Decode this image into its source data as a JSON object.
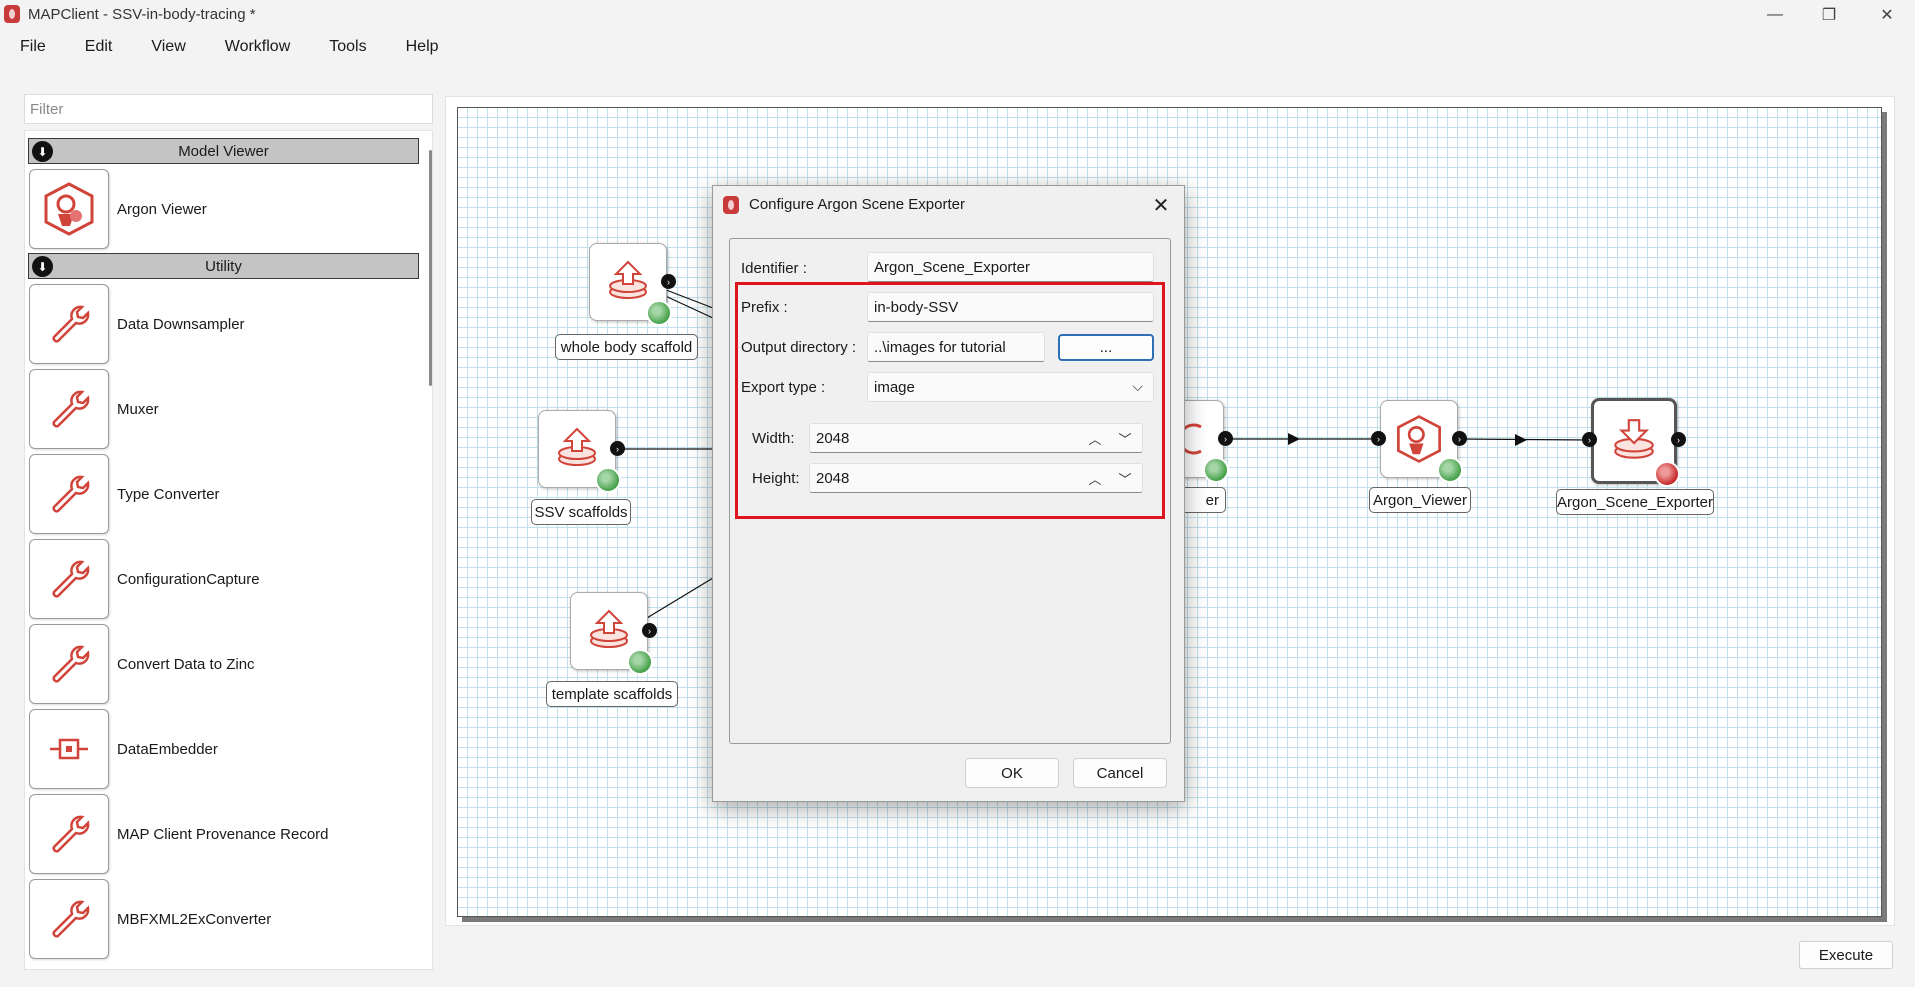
{
  "window": {
    "title": "MAPClient - SSV-in-body-tracing *",
    "minimize": "—",
    "maximize": "❐",
    "close": "✕"
  },
  "menu": [
    "File",
    "Edit",
    "View",
    "Workflow",
    "Tools",
    "Help"
  ],
  "filter": {
    "placeholder": "Filter",
    "value": ""
  },
  "categories": [
    {
      "label": "Model Viewer",
      "items": [
        "Argon Viewer"
      ]
    },
    {
      "label": "Utility",
      "items": [
        "Data Downsampler",
        "Muxer",
        "Type Converter",
        "ConfigurationCapture",
        "Convert Data to Zinc",
        "DataEmbedder",
        "MAP Client Provenance Record",
        "MBFXML2ExConverter"
      ]
    }
  ],
  "workflow_nodes": [
    {
      "label": "whole body scaffold",
      "icon": "file-upload-icon"
    },
    {
      "label": "SSV scaffolds",
      "icon": "file-upload-icon"
    },
    {
      "label": "template scaffolds",
      "icon": "file-upload-icon"
    },
    {
      "label": "er",
      "icon": "argon-icon"
    },
    {
      "label": "Argon_Viewer",
      "icon": "argon-viewer-icon"
    },
    {
      "label": "Argon_Scene_Exporter",
      "icon": "file-download-icon"
    }
  ],
  "dialog": {
    "title": "Configure Argon Scene Exporter",
    "identifier_label": "Identifier :",
    "identifier_value": "Argon_Scene_Exporter",
    "prefix_label": "Prefix :",
    "prefix_value": "in-body-SSV",
    "output_dir_label": "Output directory :",
    "output_dir_value": "..\\images for tutorial",
    "browse_label": "...",
    "export_type_label": "Export type :",
    "export_type_value": "image",
    "width_label": "Width:",
    "width_value": "2048",
    "height_label": "Height:",
    "height_value": "2048",
    "ok_label": "OK",
    "cancel_label": "Cancel"
  },
  "execute_label": "Execute",
  "colors": {
    "highlight": "#e0141e",
    "grid": "#bfe0ec",
    "accent": "#2e6fb5"
  }
}
